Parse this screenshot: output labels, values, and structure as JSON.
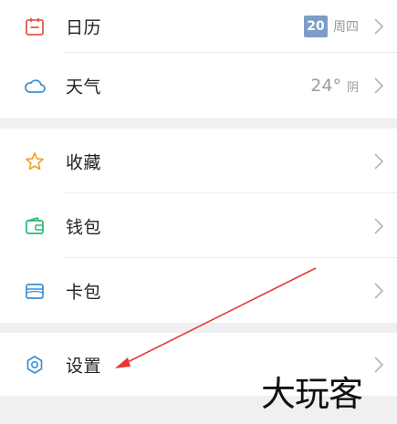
{
  "groups": [
    {
      "items": [
        {
          "id": "calendar",
          "label": "日历",
          "icon": "calendar-icon",
          "icon_color": "#e25a4c",
          "date_day": "20",
          "weekday": "周四"
        },
        {
          "id": "weather",
          "label": "天气",
          "icon": "cloud-icon",
          "icon_color": "#3a8fd6",
          "temperature": "24°",
          "condition": "阴"
        }
      ]
    },
    {
      "items": [
        {
          "id": "favorites",
          "label": "收藏",
          "icon": "star-icon",
          "icon_color": "#f0a020"
        },
        {
          "id": "wallet",
          "label": "钱包",
          "icon": "wallet-icon",
          "icon_color": "#2fb877"
        },
        {
          "id": "cardpack",
          "label": "卡包",
          "icon": "card-icon",
          "icon_color": "#3a8fd6"
        }
      ]
    },
    {
      "items": [
        {
          "id": "settings",
          "label": "设置",
          "icon": "gear-icon",
          "icon_color": "#3a8fd6"
        }
      ]
    }
  ],
  "annotation": {
    "color": "#e53935"
  },
  "watermark": "大玩客"
}
